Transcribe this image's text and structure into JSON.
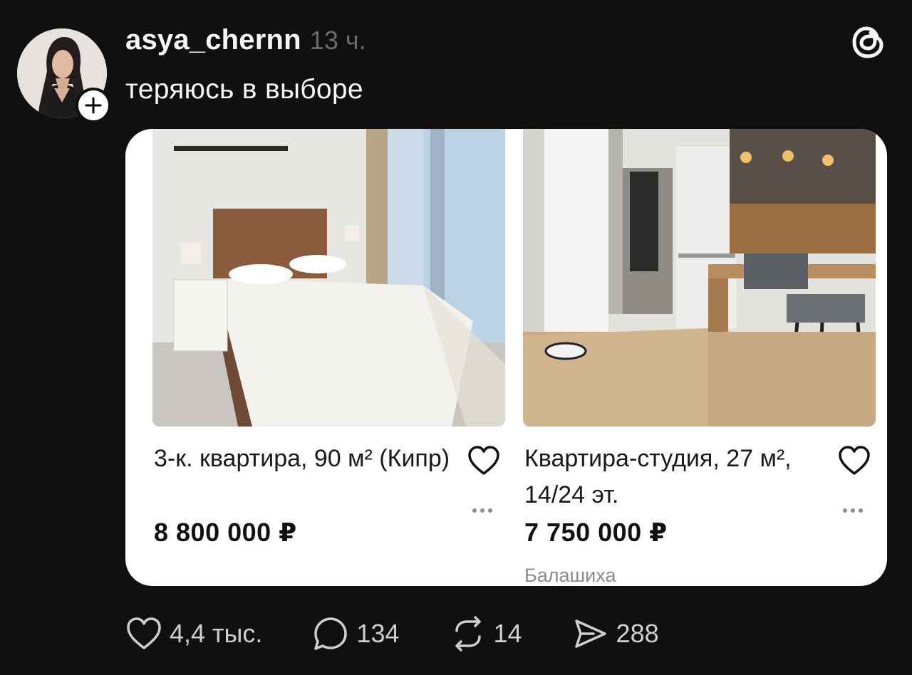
{
  "post": {
    "username": "asya_chernn",
    "time": "13 ч.",
    "text": "теряюсь в выборе"
  },
  "listings": [
    {
      "title": "3-к. квартира, 90 м² (Кипр)",
      "price": "8 800 000 ₽",
      "location": ""
    },
    {
      "title": "Квартира-студия, 27 м², 14/24 эт.",
      "price": "7 750 000 ₽",
      "location": "Балашиха"
    }
  ],
  "actions": {
    "likes": "4,4 тыс.",
    "replies": "134",
    "reposts": "14",
    "shares": "288"
  },
  "icons": [
    "follow-plus-icon",
    "threads-logo-icon",
    "heart-icon",
    "more-dots-icon",
    "reply-bubble-icon",
    "repost-icon",
    "share-send-icon"
  ],
  "colors": {
    "background": "#101010",
    "text": "#f3f5f7",
    "muted": "#6b6b6b",
    "card": "#ffffff"
  }
}
